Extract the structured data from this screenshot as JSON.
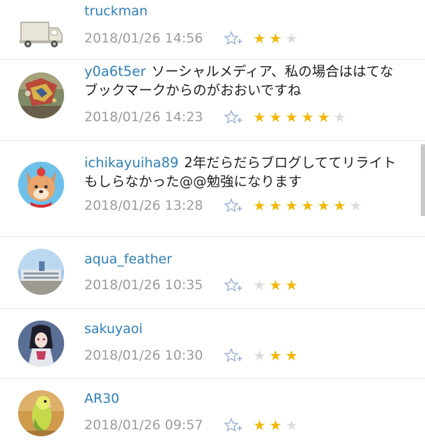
{
  "comments": [
    {
      "user": "truckman",
      "text": "",
      "date": "2018/01/26 14:56",
      "stars_before": 0,
      "gold": 2,
      "stars_after": 1
    },
    {
      "user": "y0a6t5er",
      "text": "ソーシャルメディア、私の場合ははてなブックマークからのがおおいですね",
      "date": "2018/01/26 14:23",
      "stars_before": 0,
      "gold": 5,
      "stars_after": 1
    },
    {
      "user": "ichikayuiha89",
      "text": "2年だらだらブログしててリライトもしらなかった@@勉強になります",
      "date": "2018/01/26 13:28",
      "stars_before": 0,
      "gold": 6,
      "stars_after": 1
    },
    {
      "user": "aqua_feather",
      "text": "",
      "date": "2018/01/26 10:35",
      "stars_before": 1,
      "gold": 2,
      "stars_after": 0
    },
    {
      "user": "sakuyaoi",
      "text": "",
      "date": "2018/01/26 10:30",
      "stars_before": 1,
      "gold": 2,
      "stars_after": 0
    },
    {
      "user": "AR30",
      "text": "",
      "date": "2018/01/26 09:57",
      "stars_before": 0,
      "gold": 2,
      "stars_after": 1
    }
  ],
  "icons": {
    "add_star": "add-star-icon",
    "star": "star-icon"
  },
  "colors": {
    "username": "#2f7fb8",
    "star_gold": "#f2b600",
    "star_grey": "#dcdcdc",
    "date": "#9c9c9c"
  }
}
